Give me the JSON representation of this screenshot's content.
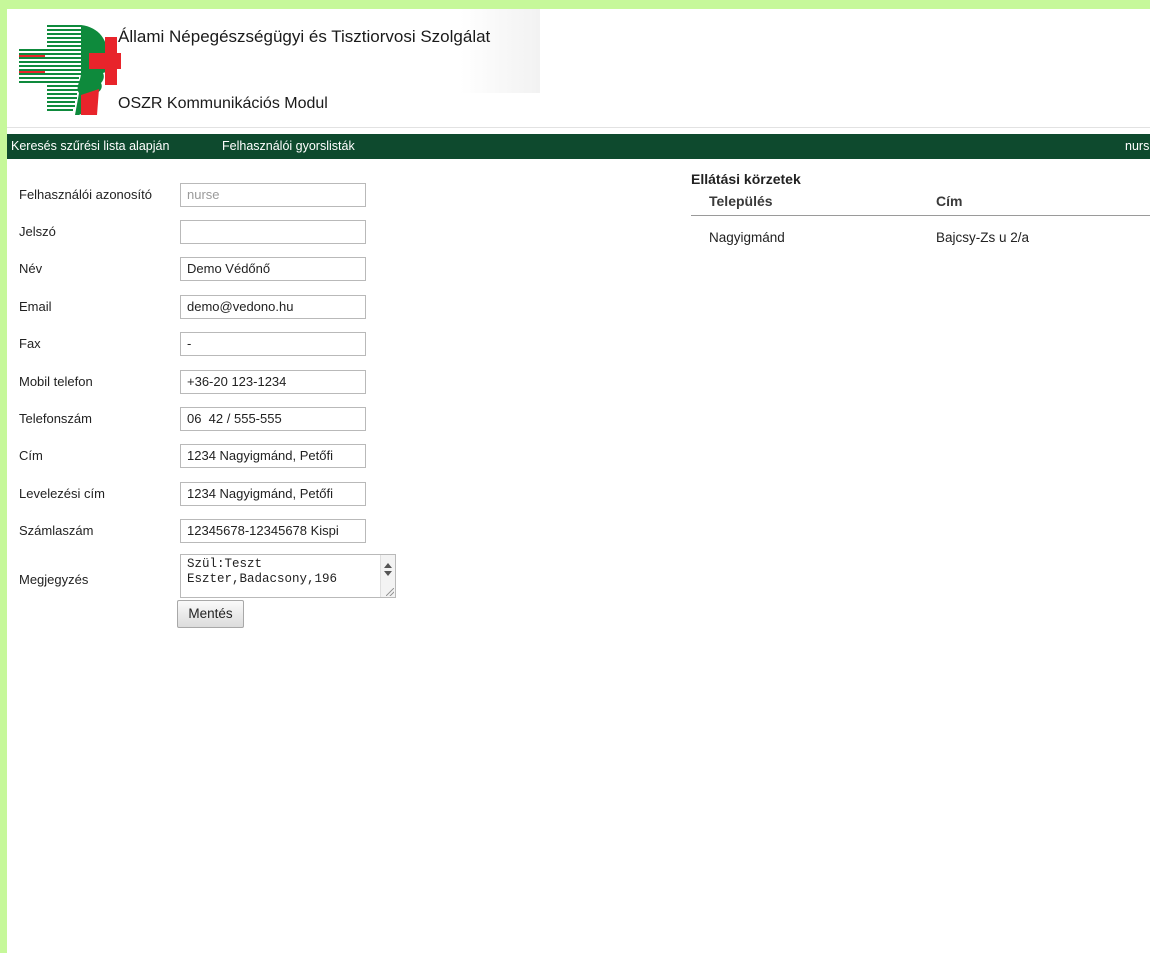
{
  "header": {
    "title": "Állami Népegészségügyi és Tisztiorvosi Szolgálat",
    "subtitle": "OSZR Kommunikációs Modul",
    "colors": {
      "green": "#0e8a3c",
      "red": "#e8242b"
    }
  },
  "nav": {
    "items": [
      {
        "label": "Keresés szűrési lista alapján"
      },
      {
        "label": "Felhasználói gyorslisták"
      }
    ],
    "user": "nurs",
    "background": "#0e4a2e"
  },
  "form": {
    "fields": [
      {
        "label": "Felhasználói azonosító",
        "value": "nurse"
      },
      {
        "label": "Jelszó",
        "value": ""
      },
      {
        "label": "Név",
        "value": "Demo Védőnő"
      },
      {
        "label": "Email",
        "value": "demo@vedono.hu"
      },
      {
        "label": "Fax",
        "value": "-"
      },
      {
        "label": "Mobil telefon",
        "value": "+36-20 123-1234"
      },
      {
        "label": "Telefonszám",
        "value": "06  42 / 555-555"
      },
      {
        "label": "Cím",
        "value": "1234 Nagyigmánd, Petőfi"
      },
      {
        "label": "Levelezési cím",
        "value": "1234 Nagyigmánd, Petőfi"
      },
      {
        "label": "Számlaszám",
        "value": "12345678-12345678 Kispi"
      }
    ],
    "notes": {
      "label": "Megjegyzés",
      "line1": "Szül:Teszt",
      "line2": "Eszter,Badacsony,196"
    },
    "save_label": "Mentés"
  },
  "districts": {
    "title": "Ellátási körzetek",
    "columns": [
      "Település",
      "Cím"
    ],
    "rows": [
      [
        "Nagyigmánd",
        "Bajcsy-Zs u 2/a"
      ]
    ]
  }
}
